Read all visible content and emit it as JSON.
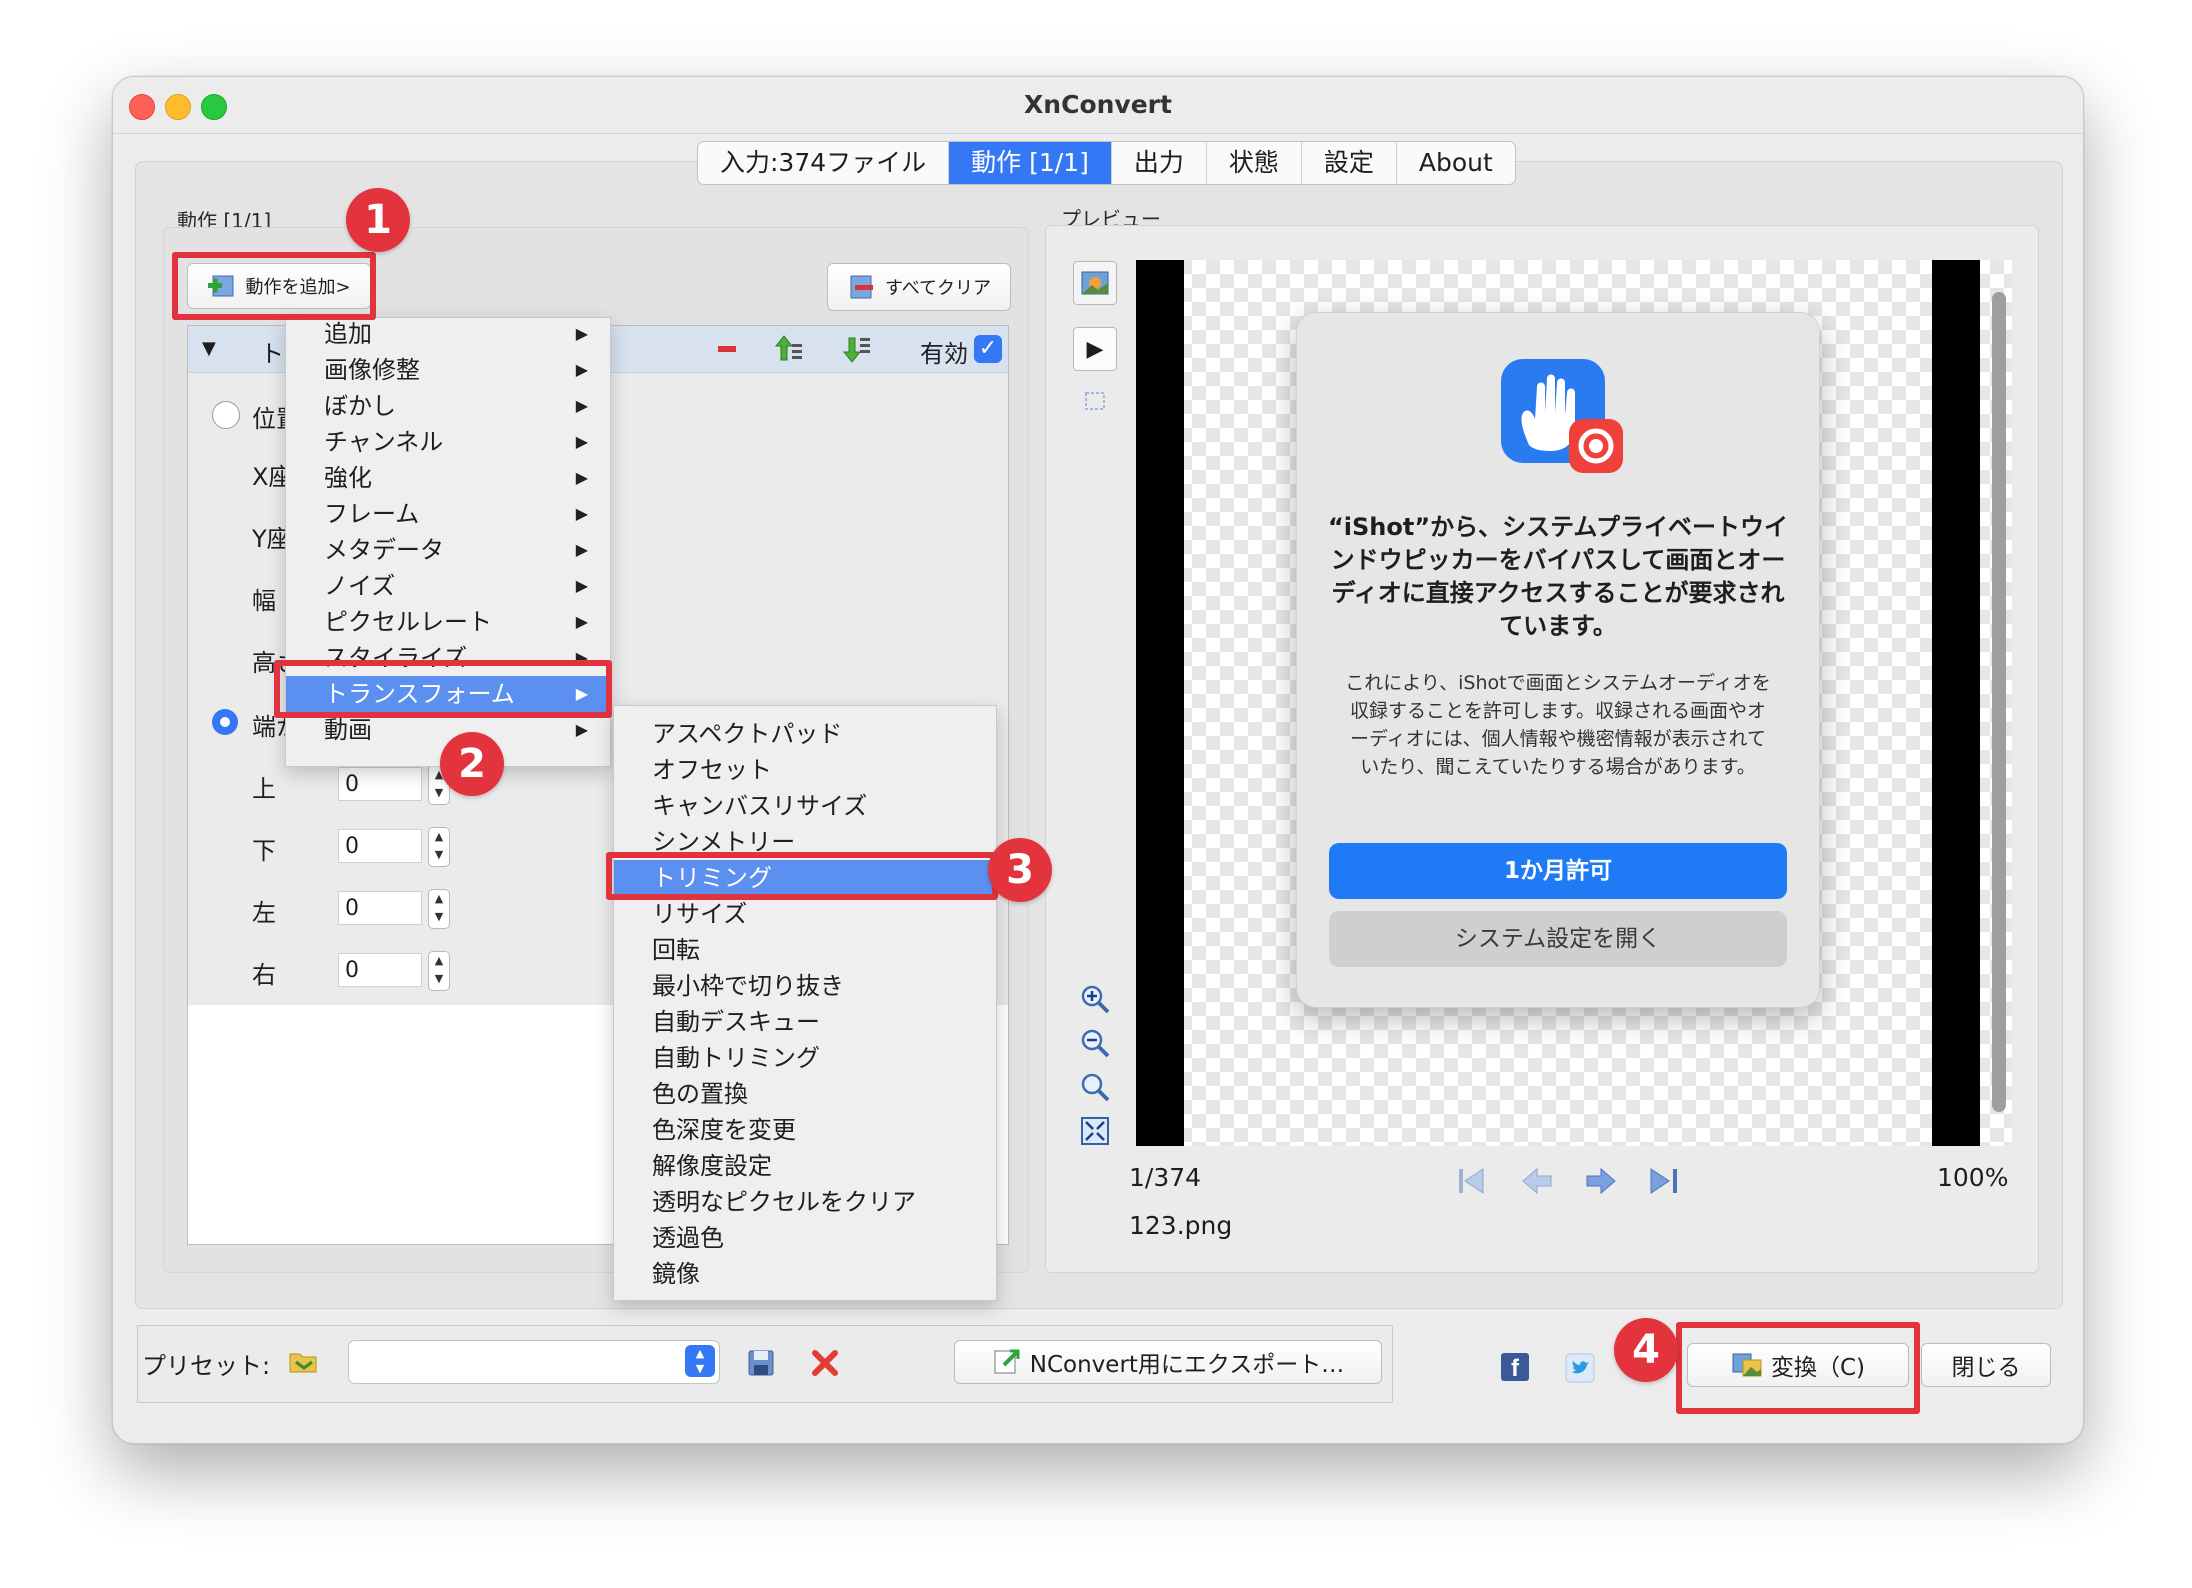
{
  "window": {
    "title": "XnConvert"
  },
  "tabs": [
    "入力:374ファイル",
    "動作 [1/1]",
    "出力",
    "状態",
    "設定",
    "About"
  ],
  "actions_panel": {
    "group_label": "動作 [1/1]",
    "add_button": "動作を追加>",
    "clear_all_button": "すべてクリア",
    "row_title": "ト",
    "enabled_label": "有効",
    "enabled_checked": true
  },
  "params": {
    "position_radio": "位置",
    "x_label": "X座",
    "y_label": "Y座",
    "width_label": "幅",
    "height_label": "高さ",
    "edge_radio": "端から",
    "fields": [
      {
        "label": "上",
        "value": "0"
      },
      {
        "label": "下",
        "value": "0"
      },
      {
        "label": "左",
        "value": "0"
      },
      {
        "label": "右",
        "value": "0"
      }
    ]
  },
  "menu": {
    "items": [
      "追加",
      "画像修整",
      "ぼかし",
      "チャンネル",
      "強化",
      "フレーム",
      "メタデータ",
      "ノイズ",
      "ピクセルレート",
      "スタイライズ",
      "トランスフォーム",
      "動画"
    ],
    "highlighted": "トランスフォーム"
  },
  "submenu": {
    "items": [
      "アスペクトパッド",
      "オフセット",
      "キャンバスリサイズ",
      "シンメトリー",
      "トリミング",
      "リサイズ",
      "回転",
      "最小枠で切り抜き",
      "自動デスキュー",
      "自動トリミング",
      "色の置換",
      "色深度を変更",
      "解像度設定",
      "透明なピクセルをクリア",
      "透過色",
      "鏡像"
    ],
    "highlighted": "トリミング"
  },
  "callouts": [
    "1",
    "2",
    "3",
    "4"
  ],
  "preview": {
    "label": "プレビュー",
    "counter": "1/374",
    "filename": "123.png",
    "zoom": "100%",
    "dialog": {
      "title": "“iShot”から、システムプライベートウインドウピッカーをバイパスして画面とオーディオに直接アクセスすることが要求されています。",
      "body": "これにより、iShotで画面とシステムオーディオを収録することを許可します。収録される画面やオーディオには、個人情報や機密情報が表示されていたり、聞こえていたりする場合があります。",
      "primary_button": "1か月許可",
      "secondary_button": "システム設定を開く"
    }
  },
  "bottom": {
    "preset_label": "プリセット:",
    "preset_value": "",
    "export_button": "NConvert用にエクスポート…",
    "convert_button": "変換（C)",
    "close_button": "閉じる"
  },
  "colors": {
    "accent": "#3478f6",
    "callout": "#e3343d",
    "menu_highlight": "#5b8ff0"
  }
}
